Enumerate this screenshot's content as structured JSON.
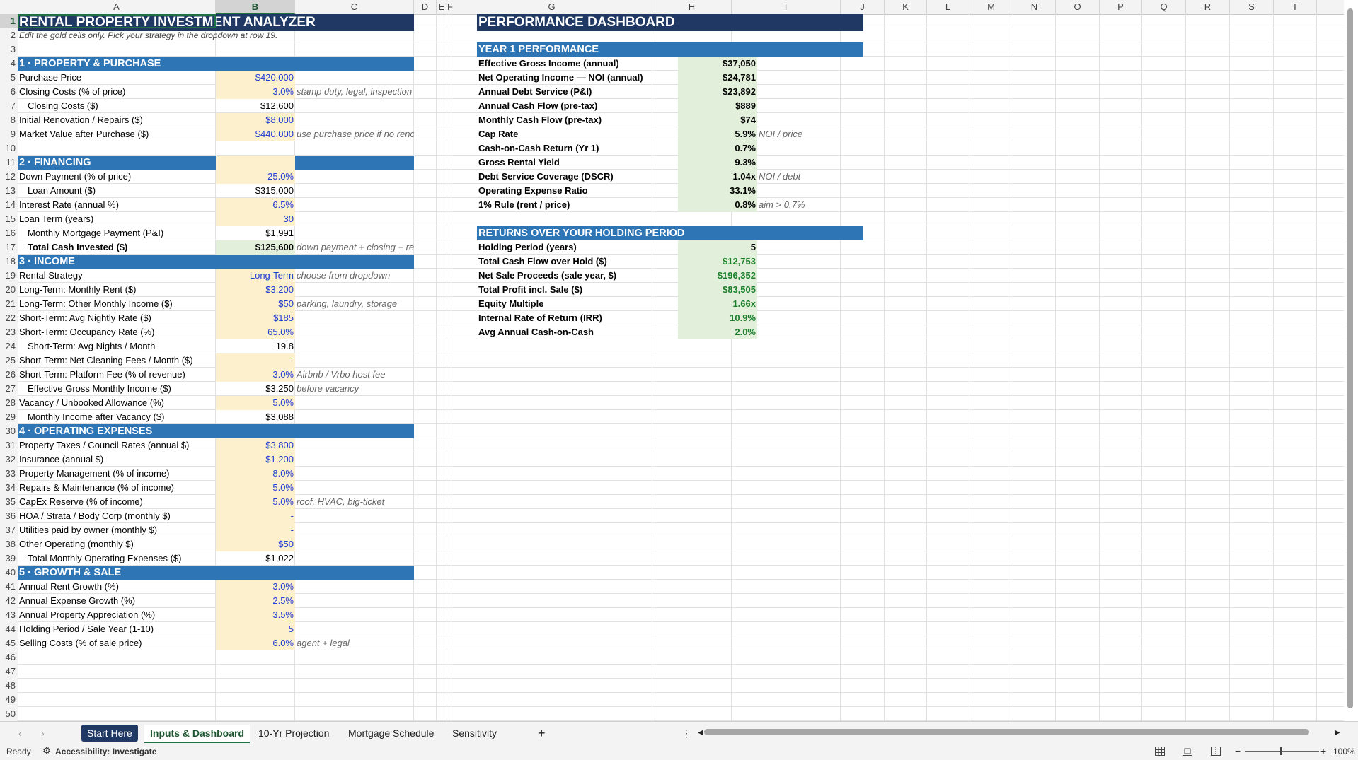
{
  "columns": [
    "A",
    "B",
    "C",
    "D",
    "E",
    "F",
    "G",
    "H",
    "I",
    "J",
    "K",
    "L",
    "M",
    "N",
    "O",
    "P",
    "Q",
    "R",
    "S",
    "T"
  ],
  "rows": [
    "1",
    "2",
    "3",
    "4",
    "5",
    "6",
    "7",
    "8",
    "9",
    "10",
    "11",
    "12",
    "13",
    "14",
    "15",
    "16",
    "17",
    "18",
    "19",
    "20",
    "21",
    "22",
    "23",
    "24",
    "25",
    "26",
    "27",
    "28",
    "29",
    "30",
    "31",
    "32",
    "33",
    "34",
    "35",
    "36",
    "37",
    "38",
    "39",
    "40",
    "41",
    "42",
    "43",
    "44",
    "45",
    "46",
    "47",
    "48",
    "49",
    "50"
  ],
  "title": "RENTAL PROPERTY INVESTMENT ANALYZER",
  "subtitle": "Edit the gold cells only. Pick your strategy in the dropdown at row 19.",
  "dashboard_title": "PERFORMANCE DASHBOARD",
  "sections": {
    "s1": "1  ·  PROPERTY & PURCHASE",
    "s2": "2  ·  FINANCING",
    "s3": "3  ·  INCOME",
    "s4": "4  ·  OPERATING EXPENSES",
    "s5": "5  ·  GROWTH & SALE"
  },
  "inputs": [
    {
      "row": 5,
      "label": "Purchase Price",
      "value": "$420,000",
      "kind": "inp",
      "note": ""
    },
    {
      "row": 6,
      "label": "Closing Costs (% of price)",
      "value": "3.0%",
      "kind": "inp",
      "note": "stamp duty, legal, inspection"
    },
    {
      "row": 7,
      "label": "Closing Costs ($)",
      "value": "$12,600",
      "kind": "calc",
      "note": "",
      "indent": true
    },
    {
      "row": 8,
      "label": "Initial Renovation / Repairs ($)",
      "value": "$8,000",
      "kind": "inp",
      "note": ""
    },
    {
      "row": 9,
      "label": "Market Value after Purchase ($)",
      "value": "$440,000",
      "kind": "inp",
      "note": "use purchase price if no reno"
    },
    {
      "row": 12,
      "label": "Down Payment (% of price)",
      "value": "25.0%",
      "kind": "inp",
      "note": ""
    },
    {
      "row": 13,
      "label": "Loan Amount ($)",
      "value": "$315,000",
      "kind": "calc",
      "note": "",
      "indent": true
    },
    {
      "row": 14,
      "label": "Interest Rate (annual %)",
      "value": "6.5%",
      "kind": "inp",
      "note": ""
    },
    {
      "row": 15,
      "label": "Loan Term (years)",
      "value": "30",
      "kind": "inp",
      "note": ""
    },
    {
      "row": 16,
      "label": "Monthly Mortgage Payment (P&I)",
      "value": "$1,991",
      "kind": "calc",
      "note": "",
      "indent": true
    },
    {
      "row": 17,
      "label": "Total Cash Invested ($)",
      "value": "$125,600",
      "kind": "calcg",
      "note": "down payment + closing + reno",
      "indent": true,
      "bold": true
    },
    {
      "row": 19,
      "label": "Rental Strategy",
      "value": "Long-Term",
      "kind": "inp",
      "note": "choose from dropdown"
    },
    {
      "row": 20,
      "label": "Long-Term: Monthly Rent ($)",
      "value": "$3,200",
      "kind": "inp",
      "note": ""
    },
    {
      "row": 21,
      "label": "Long-Term: Other Monthly Income ($)",
      "value": "$50",
      "kind": "inp",
      "note": "parking, laundry, storage"
    },
    {
      "row": 22,
      "label": "Short-Term: Avg Nightly Rate ($)",
      "value": "$185",
      "kind": "inp",
      "note": ""
    },
    {
      "row": 23,
      "label": "Short-Term: Occupancy Rate (%)",
      "value": "65.0%",
      "kind": "inp",
      "note": ""
    },
    {
      "row": 24,
      "label": "Short-Term: Avg Nights / Month",
      "value": "19.8",
      "kind": "calc",
      "note": "",
      "indent": true
    },
    {
      "row": 25,
      "label": "Short-Term: Net Cleaning Fees / Month ($)",
      "value": "-",
      "kind": "inp",
      "note": ""
    },
    {
      "row": 26,
      "label": "Short-Term: Platform Fee (% of revenue)",
      "value": "3.0%",
      "kind": "inp",
      "note": "Airbnb / Vrbo host fee"
    },
    {
      "row": 27,
      "label": "Effective Gross Monthly Income ($)",
      "value": "$3,250",
      "kind": "calc",
      "note": "before vacancy",
      "indent": true
    },
    {
      "row": 28,
      "label": "Vacancy / Unbooked Allowance (%)",
      "value": "5.0%",
      "kind": "inp",
      "note": ""
    },
    {
      "row": 29,
      "label": "Monthly Income after Vacancy ($)",
      "value": "$3,088",
      "kind": "calc",
      "note": "",
      "indent": true
    },
    {
      "row": 31,
      "label": "Property Taxes / Council Rates (annual $)",
      "value": "$3,800",
      "kind": "inp",
      "note": ""
    },
    {
      "row": 32,
      "label": "Insurance (annual $)",
      "value": "$1,200",
      "kind": "inp",
      "note": ""
    },
    {
      "row": 33,
      "label": "Property Management (% of income)",
      "value": "8.0%",
      "kind": "inp",
      "note": ""
    },
    {
      "row": 34,
      "label": "Repairs & Maintenance (% of income)",
      "value": "5.0%",
      "kind": "inp",
      "note": ""
    },
    {
      "row": 35,
      "label": "CapEx Reserve (% of income)",
      "value": "5.0%",
      "kind": "inp",
      "note": "roof, HVAC, big-ticket"
    },
    {
      "row": 36,
      "label": "HOA / Strata / Body Corp (monthly $)",
      "value": "-",
      "kind": "inp",
      "note": ""
    },
    {
      "row": 37,
      "label": "Utilities paid by owner (monthly $)",
      "value": "-",
      "kind": "inp",
      "note": ""
    },
    {
      "row": 38,
      "label": "Other Operating (monthly $)",
      "value": "$50",
      "kind": "inp",
      "note": ""
    },
    {
      "row": 39,
      "label": "Total Monthly Operating Expenses ($)",
      "value": "$1,022",
      "kind": "calc",
      "note": "",
      "indent": true
    },
    {
      "row": 41,
      "label": "Annual Rent Growth (%)",
      "value": "3.0%",
      "kind": "inp",
      "note": ""
    },
    {
      "row": 42,
      "label": "Annual Expense Growth (%)",
      "value": "2.5%",
      "kind": "inp",
      "note": ""
    },
    {
      "row": 43,
      "label": "Annual Property Appreciation (%)",
      "value": "3.5%",
      "kind": "inp",
      "note": ""
    },
    {
      "row": 44,
      "label": "Holding Period / Sale Year (1-10)",
      "value": "5",
      "kind": "inp",
      "note": ""
    },
    {
      "row": 45,
      "label": "Selling Costs (% of sale price)",
      "value": "6.0%",
      "kind": "inp",
      "note": "agent + legal"
    }
  ],
  "year1": {
    "header": "YEAR 1 PERFORMANCE",
    "items": [
      {
        "label": "Effective Gross Income (annual)",
        "value": "$37,050",
        "note": ""
      },
      {
        "label": "Net Operating Income — NOI (annual)",
        "value": "$24,781",
        "note": ""
      },
      {
        "label": "Annual Debt Service (P&I)",
        "value": "$23,892",
        "note": ""
      },
      {
        "label": "Annual Cash Flow (pre-tax)",
        "value": "$889",
        "note": ""
      },
      {
        "label": "Monthly Cash Flow (pre-tax)",
        "value": "$74",
        "note": ""
      },
      {
        "label": "Cap Rate",
        "value": "5.9%",
        "note": "NOI / price"
      },
      {
        "label": "Cash-on-Cash Return (Yr 1)",
        "value": "0.7%",
        "note": ""
      },
      {
        "label": "Gross Rental Yield",
        "value": "9.3%",
        "note": ""
      },
      {
        "label": "Debt Service Coverage (DSCR)",
        "value": "1.04x",
        "note": "NOI / debt"
      },
      {
        "label": "Operating Expense Ratio",
        "value": "33.1%",
        "note": ""
      },
      {
        "label": "1% Rule (rent / price)",
        "value": "0.8%",
        "note": "aim > 0.7%"
      }
    ]
  },
  "returns": {
    "header": "RETURNS OVER YOUR HOLDING PERIOD",
    "items": [
      {
        "label": "Holding Period (years)",
        "value": "5",
        "style": "plain"
      },
      {
        "label": "Total Cash Flow over Hold ($)",
        "value": "$12,753",
        "style": "green"
      },
      {
        "label": "Net Sale Proceeds (sale year, $)",
        "value": "$196,352",
        "style": "green"
      },
      {
        "label": "Total Profit incl. Sale ($)",
        "value": "$83,505",
        "style": "green"
      },
      {
        "label": "Equity Multiple",
        "value": "1.66x",
        "style": "green"
      },
      {
        "label": "Internal Rate of Return (IRR)",
        "value": "10.9%",
        "style": "green"
      },
      {
        "label": "Avg Annual Cash-on-Cash",
        "value": "2.0%",
        "style": "green"
      }
    ]
  },
  "tabs": [
    {
      "label": "Start Here",
      "kind": "start"
    },
    {
      "label": "Inputs & Dashboard",
      "kind": "active"
    },
    {
      "label": "10-Yr Projection",
      "kind": "normal"
    },
    {
      "label": "Mortgage Schedule",
      "kind": "normal"
    },
    {
      "label": "Sensitivity",
      "kind": "normal"
    }
  ],
  "status": {
    "ready": "Ready",
    "accessibility": "Accessibility: Investigate",
    "zoom": "100%"
  },
  "icons": {
    "prev_sheet": "chevron-left-icon",
    "next_sheet": "chevron-right-icon",
    "add_sheet": "plus-icon",
    "more": "more-vertical-icon",
    "normal_view": "grid-view-icon",
    "page_layout": "page-layout-icon",
    "page_break": "page-break-icon"
  },
  "colors": {
    "title_band": "#1f3864",
    "section_band": "#2e75b6",
    "input_fill": "#fdf0cc",
    "input_text": "#1f3fd0",
    "calc_fill": "#e2efda",
    "positive_text": "#1a7f2a"
  }
}
